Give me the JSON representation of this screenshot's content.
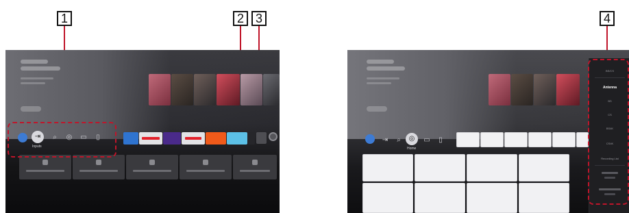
{
  "callouts": {
    "c1": "1",
    "c2": "2",
    "c3": "3",
    "c4": "4"
  },
  "screen1": {
    "nav_items": [
      {
        "icon": "account-icon"
      },
      {
        "icon": "inputs-icon",
        "label": "Inputs"
      },
      {
        "icon": "search-icon"
      },
      {
        "icon": "broadcast-icon"
      },
      {
        "icon": "recordings-icon"
      },
      {
        "icon": "apps-icon"
      }
    ],
    "lower_tiles": [
      {
        "icon": "input-icon"
      },
      {
        "icon": "input-icon"
      },
      {
        "icon": "input-icon"
      },
      {
        "icon": "input-icon"
      },
      {
        "icon": "input-icon"
      }
    ]
  },
  "screen2": {
    "nav_items": [
      {
        "icon": "account-icon"
      },
      {
        "icon": "inputs-icon"
      },
      {
        "icon": "search-icon"
      },
      {
        "icon": "broadcast-icon",
        "label": "Home"
      },
      {
        "icon": "recordings-icon"
      },
      {
        "icon": "apps-icon"
      }
    ],
    "menu": {
      "items": [
        "BS/CS",
        "Antenna",
        "BS",
        "CS",
        "BS4K",
        "CS4K",
        "Recording List",
        "",
        ""
      ],
      "selected_index": 1
    }
  },
  "colors": {
    "accent_red": "#c0152a",
    "avatar_blue": "#3d7bd4"
  }
}
